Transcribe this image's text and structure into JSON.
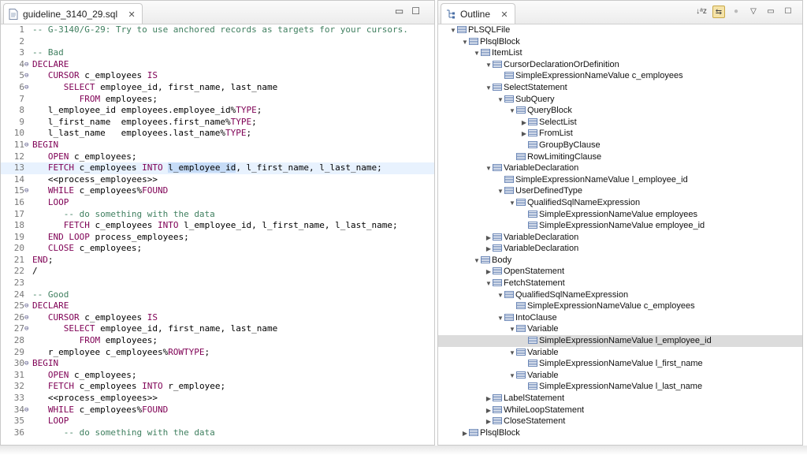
{
  "editor": {
    "tab_title": "guideline_3140_29.sql",
    "close_glyph": "✕",
    "lines": [
      {
        "n": "1",
        "fold": "",
        "hl": false,
        "parts": [
          [
            "cm",
            "-- G-3140/G-29: Try to use anchored records as targets for your cursors."
          ]
        ]
      },
      {
        "n": "2",
        "fold": "",
        "hl": false,
        "parts": []
      },
      {
        "n": "3",
        "fold": "",
        "hl": false,
        "parts": [
          [
            "cm",
            "-- Bad"
          ]
        ]
      },
      {
        "n": "4",
        "fold": "⊖",
        "hl": false,
        "parts": [
          [
            "kw",
            "DECLARE"
          ]
        ]
      },
      {
        "n": "5",
        "fold": "⊖",
        "hl": false,
        "parts": [
          [
            "t",
            "   "
          ],
          [
            "kw",
            "CURSOR"
          ],
          [
            "t",
            " c_employees "
          ],
          [
            "kw",
            "IS"
          ]
        ]
      },
      {
        "n": "6",
        "fold": "⊖",
        "hl": false,
        "parts": [
          [
            "t",
            "      "
          ],
          [
            "kw",
            "SELECT"
          ],
          [
            "t",
            " employee_id, first_name, last_name"
          ]
        ]
      },
      {
        "n": "7",
        "fold": "",
        "hl": false,
        "parts": [
          [
            "t",
            "         "
          ],
          [
            "kw",
            "FROM"
          ],
          [
            "t",
            " employees;"
          ]
        ]
      },
      {
        "n": "8",
        "fold": "",
        "hl": false,
        "parts": [
          [
            "t",
            "   l_employee_id employees.employee_id%"
          ],
          [
            "kw",
            "TYPE"
          ],
          [
            "t",
            ";"
          ]
        ]
      },
      {
        "n": "9",
        "fold": "",
        "hl": false,
        "parts": [
          [
            "t",
            "   l_first_name  employees.first_name%"
          ],
          [
            "kw",
            "TYPE"
          ],
          [
            "t",
            ";"
          ]
        ]
      },
      {
        "n": "10",
        "fold": "",
        "hl": false,
        "parts": [
          [
            "t",
            "   l_last_name   employees.last_name%"
          ],
          [
            "kw",
            "TYPE"
          ],
          [
            "t",
            ";"
          ]
        ]
      },
      {
        "n": "11",
        "fold": "⊖",
        "hl": false,
        "parts": [
          [
            "kw",
            "BEGIN"
          ]
        ]
      },
      {
        "n": "12",
        "fold": "",
        "hl": false,
        "parts": [
          [
            "t",
            "   "
          ],
          [
            "kw",
            "OPEN"
          ],
          [
            "t",
            " c_employees;"
          ]
        ]
      },
      {
        "n": "13",
        "fold": "",
        "hl": true,
        "parts": [
          [
            "t",
            "   "
          ],
          [
            "kw",
            "FETCH"
          ],
          [
            "t",
            " c_employees "
          ],
          [
            "kw",
            "INTO"
          ],
          [
            "t",
            " "
          ],
          [
            "sel",
            "l_employee_id"
          ],
          [
            "t",
            ", l_first_name, l_last_name;"
          ]
        ]
      },
      {
        "n": "14",
        "fold": "",
        "hl": false,
        "parts": [
          [
            "t",
            "   <<process_employees>>"
          ]
        ]
      },
      {
        "n": "15",
        "fold": "⊖",
        "hl": false,
        "parts": [
          [
            "t",
            "   "
          ],
          [
            "kw",
            "WHILE"
          ],
          [
            "t",
            " c_employees%"
          ],
          [
            "kw",
            "FOUND"
          ]
        ]
      },
      {
        "n": "16",
        "fold": "",
        "hl": false,
        "parts": [
          [
            "t",
            "   "
          ],
          [
            "kw",
            "LOOP"
          ]
        ]
      },
      {
        "n": "17",
        "fold": "",
        "hl": false,
        "parts": [
          [
            "t",
            "      "
          ],
          [
            "cm",
            "-- do something with the data"
          ]
        ]
      },
      {
        "n": "18",
        "fold": "",
        "hl": false,
        "parts": [
          [
            "t",
            "      "
          ],
          [
            "kw",
            "FETCH"
          ],
          [
            "t",
            " c_employees "
          ],
          [
            "kw",
            "INTO"
          ],
          [
            "t",
            " l_employee_id, l_first_name, l_last_name;"
          ]
        ]
      },
      {
        "n": "19",
        "fold": "",
        "hl": false,
        "parts": [
          [
            "t",
            "   "
          ],
          [
            "kw",
            "END LOOP"
          ],
          [
            "t",
            " process_employees;"
          ]
        ]
      },
      {
        "n": "20",
        "fold": "",
        "hl": false,
        "parts": [
          [
            "t",
            "   "
          ],
          [
            "kw",
            "CLOSE"
          ],
          [
            "t",
            " c_employees;"
          ]
        ]
      },
      {
        "n": "21",
        "fold": "",
        "hl": false,
        "parts": [
          [
            "kw",
            "END"
          ],
          [
            "t",
            ";"
          ]
        ]
      },
      {
        "n": "22",
        "fold": "",
        "hl": false,
        "parts": [
          [
            "t",
            "/"
          ]
        ]
      },
      {
        "n": "23",
        "fold": "",
        "hl": false,
        "parts": []
      },
      {
        "n": "24",
        "fold": "",
        "hl": false,
        "parts": [
          [
            "cm",
            "-- Good"
          ]
        ]
      },
      {
        "n": "25",
        "fold": "⊖",
        "hl": false,
        "parts": [
          [
            "kw",
            "DECLARE"
          ]
        ]
      },
      {
        "n": "26",
        "fold": "⊖",
        "hl": false,
        "parts": [
          [
            "t",
            "   "
          ],
          [
            "kw",
            "CURSOR"
          ],
          [
            "t",
            " c_employees "
          ],
          [
            "kw",
            "IS"
          ]
        ]
      },
      {
        "n": "27",
        "fold": "⊖",
        "hl": false,
        "parts": [
          [
            "t",
            "      "
          ],
          [
            "kw",
            "SELECT"
          ],
          [
            "t",
            " employee_id, first_name, last_name"
          ]
        ]
      },
      {
        "n": "28",
        "fold": "",
        "hl": false,
        "parts": [
          [
            "t",
            "         "
          ],
          [
            "kw",
            "FROM"
          ],
          [
            "t",
            " employees;"
          ]
        ]
      },
      {
        "n": "29",
        "fold": "",
        "hl": false,
        "parts": [
          [
            "t",
            "   r_employee c_employees%"
          ],
          [
            "kw",
            "ROWTYPE"
          ],
          [
            "t",
            ";"
          ]
        ]
      },
      {
        "n": "30",
        "fold": "⊖",
        "hl": false,
        "parts": [
          [
            "kw",
            "BEGIN"
          ]
        ]
      },
      {
        "n": "31",
        "fold": "",
        "hl": false,
        "parts": [
          [
            "t",
            "   "
          ],
          [
            "kw",
            "OPEN"
          ],
          [
            "t",
            " c_employees;"
          ]
        ]
      },
      {
        "n": "32",
        "fold": "",
        "hl": false,
        "parts": [
          [
            "t",
            "   "
          ],
          [
            "kw",
            "FETCH"
          ],
          [
            "t",
            " c_employees "
          ],
          [
            "kw",
            "INTO"
          ],
          [
            "t",
            " r_employee;"
          ]
        ]
      },
      {
        "n": "33",
        "fold": "",
        "hl": false,
        "parts": [
          [
            "t",
            "   <<process_employees>>"
          ]
        ]
      },
      {
        "n": "34",
        "fold": "⊖",
        "hl": false,
        "parts": [
          [
            "t",
            "   "
          ],
          [
            "kw",
            "WHILE"
          ],
          [
            "t",
            " c_employees%"
          ],
          [
            "kw",
            "FOUND"
          ]
        ]
      },
      {
        "n": "35",
        "fold": "",
        "hl": false,
        "parts": [
          [
            "t",
            "   "
          ],
          [
            "kw",
            "LOOP"
          ]
        ]
      },
      {
        "n": "36",
        "fold": "",
        "hl": false,
        "parts": [
          [
            "t",
            "      "
          ],
          [
            "cm",
            "-- do something with the data"
          ]
        ]
      }
    ]
  },
  "outline": {
    "tab_title": "Outline",
    "close_glyph": "✕",
    "nodes": [
      {
        "d": 0,
        "a": "▼",
        "label": "PLSQLFile",
        "sel": false
      },
      {
        "d": 1,
        "a": "▼",
        "label": "PlsqlBlock",
        "sel": false
      },
      {
        "d": 2,
        "a": "▼",
        "label": "ItemList",
        "sel": false
      },
      {
        "d": 3,
        "a": "▼",
        "label": "CursorDeclarationOrDefinition",
        "sel": false
      },
      {
        "d": 4,
        "a": "",
        "label": "SimpleExpressionNameValue c_employees",
        "sel": false
      },
      {
        "d": 3,
        "a": "▼",
        "label": "SelectStatement",
        "sel": false
      },
      {
        "d": 4,
        "a": "▼",
        "label": "SubQuery",
        "sel": false
      },
      {
        "d": 5,
        "a": "▼",
        "label": "QueryBlock",
        "sel": false
      },
      {
        "d": 6,
        "a": "▶",
        "label": "SelectList",
        "sel": false
      },
      {
        "d": 6,
        "a": "▶",
        "label": "FromList",
        "sel": false
      },
      {
        "d": 6,
        "a": "",
        "label": "GroupByClause",
        "sel": false
      },
      {
        "d": 5,
        "a": "",
        "label": "RowLimitingClause",
        "sel": false
      },
      {
        "d": 3,
        "a": "▼",
        "label": "VariableDeclaration",
        "sel": false
      },
      {
        "d": 4,
        "a": "",
        "label": "SimpleExpressionNameValue l_employee_id",
        "sel": false
      },
      {
        "d": 4,
        "a": "▼",
        "label": "UserDefinedType",
        "sel": false
      },
      {
        "d": 5,
        "a": "▼",
        "label": "QualifiedSqlNameExpression",
        "sel": false
      },
      {
        "d": 6,
        "a": "",
        "label": "SimpleExpressionNameValue employees",
        "sel": false
      },
      {
        "d": 6,
        "a": "",
        "label": "SimpleExpressionNameValue employee_id",
        "sel": false
      },
      {
        "d": 3,
        "a": "▶",
        "label": "VariableDeclaration",
        "sel": false
      },
      {
        "d": 3,
        "a": "▶",
        "label": "VariableDeclaration",
        "sel": false
      },
      {
        "d": 2,
        "a": "▼",
        "label": "Body",
        "sel": false
      },
      {
        "d": 3,
        "a": "▶",
        "label": "OpenStatement",
        "sel": false
      },
      {
        "d": 3,
        "a": "▼",
        "label": "FetchStatement",
        "sel": false
      },
      {
        "d": 4,
        "a": "▼",
        "label": "QualifiedSqlNameExpression",
        "sel": false
      },
      {
        "d": 5,
        "a": "",
        "label": "SimpleExpressionNameValue c_employees",
        "sel": false
      },
      {
        "d": 4,
        "a": "▼",
        "label": "IntoClause",
        "sel": false
      },
      {
        "d": 5,
        "a": "▼",
        "label": "Variable",
        "sel": false
      },
      {
        "d": 6,
        "a": "",
        "label": "SimpleExpressionNameValue l_employee_id",
        "sel": true
      },
      {
        "d": 5,
        "a": "▼",
        "label": "Variable",
        "sel": false
      },
      {
        "d": 6,
        "a": "",
        "label": "SimpleExpressionNameValue l_first_name",
        "sel": false
      },
      {
        "d": 5,
        "a": "▼",
        "label": "Variable",
        "sel": false
      },
      {
        "d": 6,
        "a": "",
        "label": "SimpleExpressionNameValue l_last_name",
        "sel": false
      },
      {
        "d": 3,
        "a": "▶",
        "label": "LabelStatement",
        "sel": false
      },
      {
        "d": 3,
        "a": "▶",
        "label": "WhileLoopStatement",
        "sel": false
      },
      {
        "d": 3,
        "a": "▶",
        "label": "CloseStatement",
        "sel": false
      },
      {
        "d": 1,
        "a": "▶",
        "label": "PlsqlBlock",
        "sel": false
      }
    ]
  },
  "colors": {
    "keyword": "#7f0055",
    "comment": "#3f7f5f",
    "selection": "#c6dcf7",
    "current_line": "#e8f2fe"
  },
  "icons": [
    "sql-file-icon",
    "outline-icon",
    "sort-az-icon",
    "link-with-editor-icon",
    "filter-icon",
    "view-menu-icon",
    "minimize-icon",
    "maximize-icon",
    "tree-node-icon"
  ]
}
